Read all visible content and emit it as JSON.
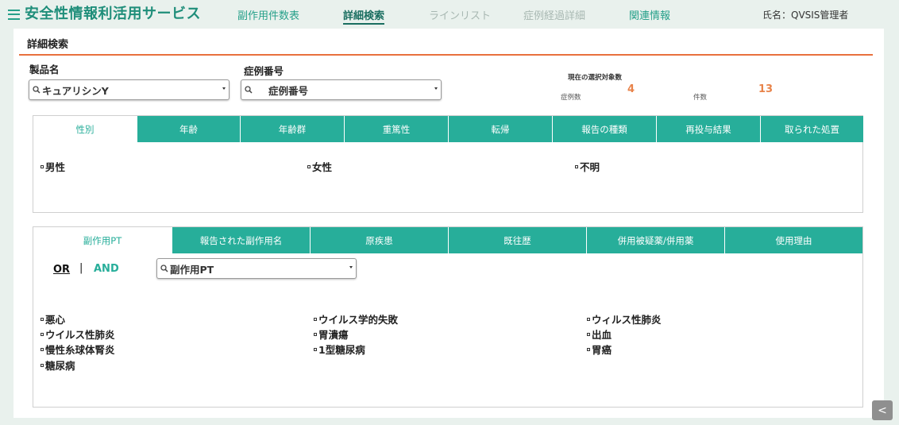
{
  "header": {
    "app_title": "安全性情報利活用サービス",
    "nav": [
      {
        "label": "副作用件数表",
        "state": "normal"
      },
      {
        "label": "詳細検索",
        "state": "active"
      },
      {
        "label": "ラインリスト",
        "state": "disabled"
      },
      {
        "label": "症例経過詳細",
        "state": "disabled"
      },
      {
        "label": "関連情報",
        "state": "normal"
      }
    ],
    "user": "氏名：QVSIS管理者"
  },
  "page": {
    "title": "詳細検索"
  },
  "filters": {
    "product": {
      "label": "製品名",
      "value": "キュアリシンY"
    },
    "case_number": {
      "label": "症例番号",
      "placeholder": "症例番号"
    }
  },
  "selection": {
    "title": "現在の選択対象数",
    "cases_label": "症例数",
    "cases_value": "4",
    "count_label": "件数",
    "count_value": "13"
  },
  "patient_tabs": {
    "tabs": [
      "性別",
      "年齢",
      "年齢群",
      "重篤性",
      "転帰",
      "報告の種類",
      "再投与結果",
      "取られた処置"
    ],
    "active_index": 0,
    "options": [
      "男性",
      "女性",
      "不明"
    ]
  },
  "event_tabs": {
    "tabs": [
      "副作用PT",
      "報告された副作用名",
      "原疾患",
      "既往歴",
      "併用被疑薬/併用薬",
      "使用理由"
    ],
    "active_index": 0,
    "logic_or": "OR",
    "logic_sep": "|",
    "logic_and": "AND",
    "pt_select": "副作用PT",
    "options": [
      "悪心",
      "ウイルス学的失敗",
      "ウィルス性肺炎",
      "ウイルス性肺炎",
      "胃潰瘍",
      "出血",
      "慢性糸球体腎炎",
      "1型糖尿病",
      "胃癌",
      "糖尿病"
    ]
  },
  "collapse_label": "<",
  "colors": {
    "accent": "#27ae9a",
    "rule": "#e8703e",
    "count": "#e8834a"
  }
}
